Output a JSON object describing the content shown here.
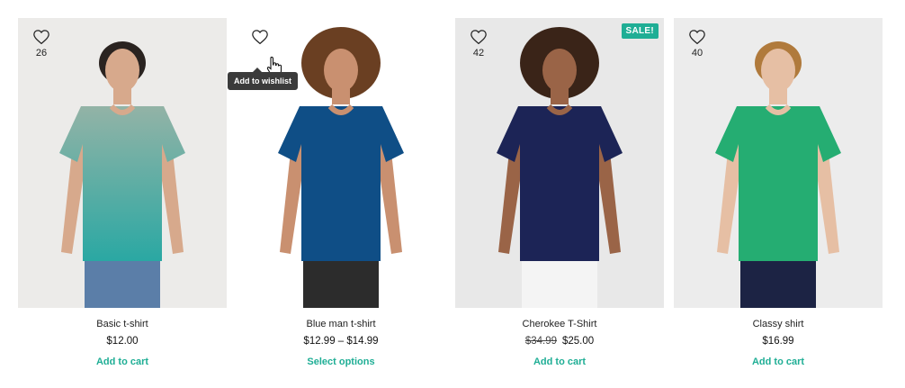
{
  "colors": {
    "accent": "#1fae95",
    "tooltip_bg": "#3b3b3b",
    "text": "#222222"
  },
  "wishlist_tooltip": "Add to wishlist",
  "products": [
    {
      "title": "Basic t-shirt",
      "price": "$12.00",
      "cta": "Add to cart",
      "wishlist_count": "26",
      "bg": "#ecebe9",
      "shirt": "#93b3a6",
      "shirt_bottom": "#2aa8a3",
      "pants": "#5b7ea8",
      "skin": "#d7a98c",
      "hair": "#2a2320"
    },
    {
      "title": "Blue man t-shirt",
      "price": "$12.99 – $14.99",
      "cta": "Select options",
      "wishlist_count": "",
      "bg": "#ffffff",
      "shirt": "#0f4e86",
      "shirt_bottom": "#0f4e86",
      "pants": "#2c2c2c",
      "skin": "#c99070",
      "hair": "#6a3f22"
    },
    {
      "title": "Cherokee T-Shirt",
      "price_old": "$34.99",
      "price": "$25.00",
      "cta": "Add to cart",
      "wishlist_count": "42",
      "sale_badge": "SALE!",
      "bg": "#e8e8e8",
      "shirt": "#1c2456",
      "shirt_bottom": "#1c2456",
      "pants": "#f4f4f4",
      "skin": "#9a6447",
      "hair": "#3a2418"
    },
    {
      "title": "Classy shirt",
      "price": "$16.99",
      "cta": "Add to cart",
      "wishlist_count": "40",
      "bg": "#ececec",
      "shirt": "#25ad72",
      "shirt_bottom": "#25ad72",
      "pants": "#1c2344",
      "skin": "#e6bfa4",
      "hair": "#b07a3c"
    }
  ]
}
